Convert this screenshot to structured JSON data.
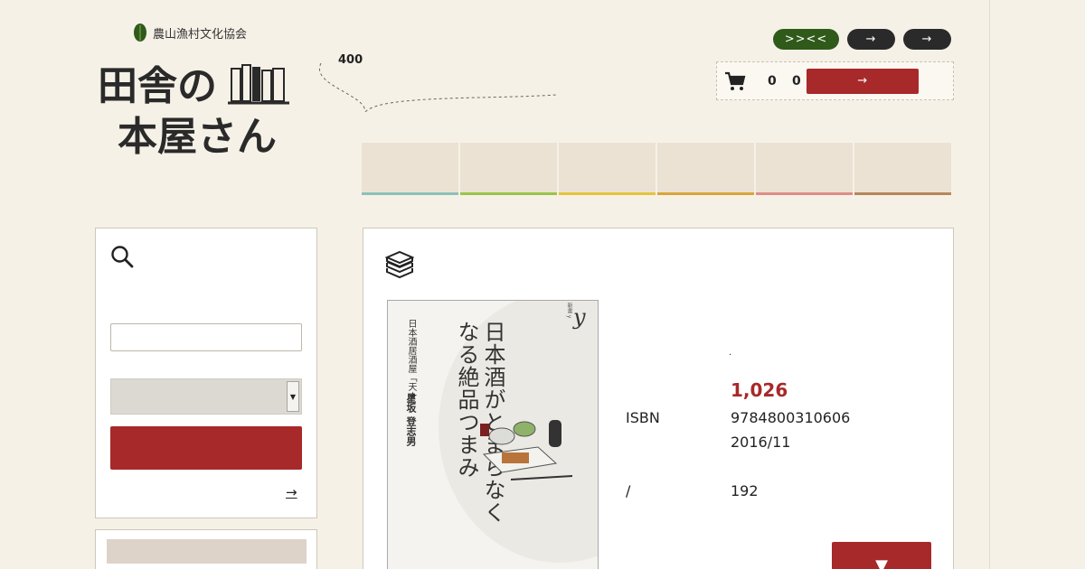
{
  "header": {
    "org_name": "農山漁村文化協会",
    "logo_line1": "田舎の",
    "logo_line2": "本屋さん",
    "tagline": "",
    "promo_text": "400"
  },
  "top_buttons": [
    {
      "label": ">><<",
      "color": "#2f5a1a"
    },
    {
      "label": "→",
      "color": "#2a2a2a"
    },
    {
      "label": "→",
      "color": "#2a2a2a"
    }
  ],
  "cart": {
    "count": "0",
    "total": "0",
    "unit": "",
    "button_label": "→"
  },
  "nav": {
    "items": [
      {
        "label": "",
        "color": "#8cc1ba"
      },
      {
        "label": "",
        "color": "#9bc44a"
      },
      {
        "label": "",
        "color": "#e3c43a"
      },
      {
        "label": "",
        "color": "#d9a53a"
      },
      {
        "label": "",
        "color": "#dd8e86"
      },
      {
        "label": "",
        "color": "#b6875c"
      }
    ]
  },
  "sidebar": {
    "search_placeholder": "",
    "select_value": "",
    "search_button_label": " ",
    "more_link": "→"
  },
  "book": {
    "cover_title": "日本酒がとまらなくなる絶品つまみ",
    "cover_subtitle": "日本酒居酒屋「天★」",
    "cover_author": "星坂 登志男",
    "cover_series": "新書 y",
    "cover_logo": "y",
    "title_dot": ".",
    "price": "1,026",
    "price_unit": "",
    "isbn_label": "ISBN",
    "isbn": "9784800310606",
    "date": "2016/11",
    "pages_label": "/",
    "pages": "192",
    "cart_button_label": "▼"
  }
}
